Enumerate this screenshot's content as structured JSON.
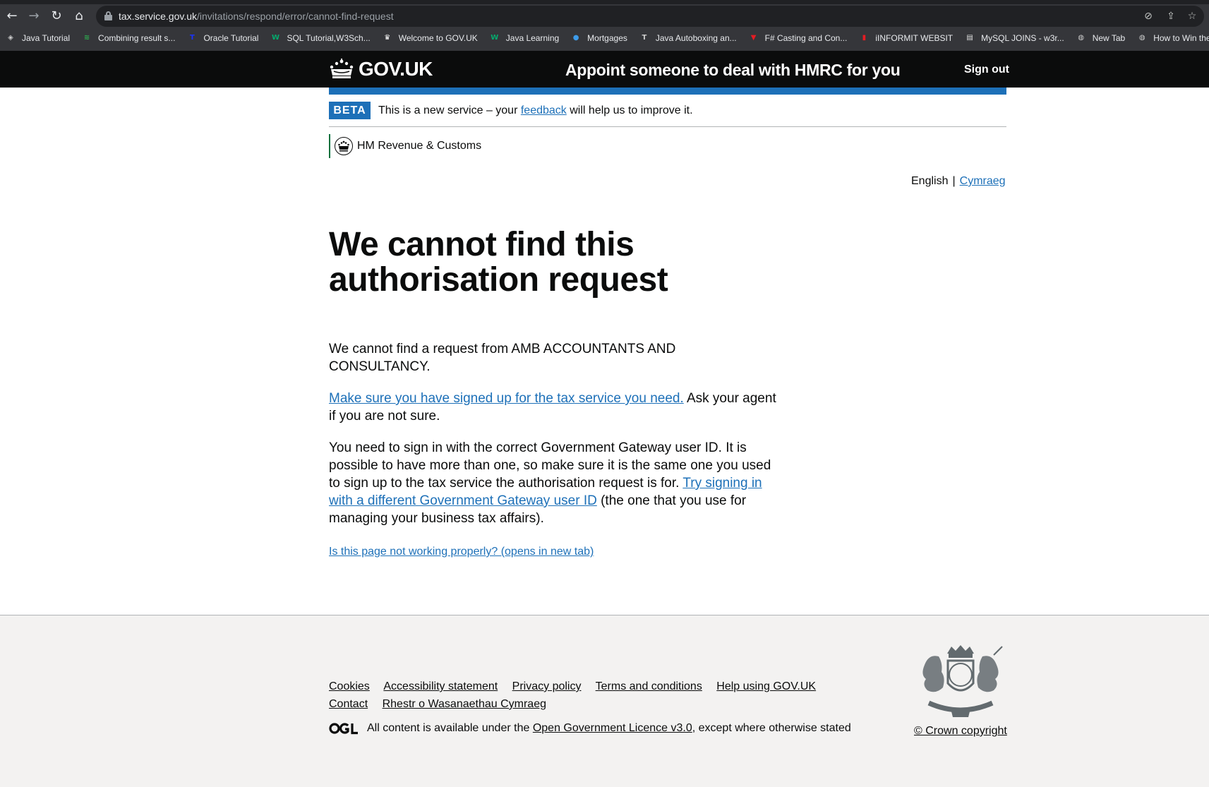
{
  "browser": {
    "url_host": "tax.service.gov.uk",
    "url_path": "/invitations/respond/error/cannot-find-request",
    "bookmarks": [
      {
        "label": "Java Tutorial",
        "icon": "tutorial-icon",
        "color": "#cccccc"
      },
      {
        "label": "Combining result s...",
        "icon": "stack-icon",
        "color": "#2fa84f"
      },
      {
        "label": "Oracle Tutorial",
        "icon": "t-letter-icon",
        "color": "#1a33ff"
      },
      {
        "label": "SQL Tutorial,W3Sch...",
        "icon": "w3-icon",
        "color": "#04aa6d"
      },
      {
        "label": "Welcome to GOV.UK",
        "icon": "crown-icon",
        "color": "#ffffff"
      },
      {
        "label": "Java Learning",
        "icon": "w3-icon",
        "color": "#04aa6d"
      },
      {
        "label": "Mortgages",
        "icon": "drop-icon",
        "color": "#3d9be9"
      },
      {
        "label": "Java Autoboxing an...",
        "icon": "t-serif-icon",
        "color": "#cccccc"
      },
      {
        "label": "F# Casting and Con...",
        "icon": "shield-icon",
        "color": "#e51c23"
      },
      {
        "label": "iINFORMIT WEBSIT",
        "icon": "bookmark-icon",
        "color": "#e51c23"
      },
      {
        "label": "MySQL JOINS - w3r...",
        "icon": "mysql-icon",
        "color": "#dddddd"
      },
      {
        "label": "New Tab",
        "icon": "globe-icon",
        "color": "#cccccc"
      },
      {
        "label": "How to Win the Chr...",
        "icon": "globe-icon",
        "color": "#cccccc"
      }
    ]
  },
  "header": {
    "logo_text": "GOV.UK",
    "service_name": "Appoint someone to deal with HMRC for you",
    "sign_out": "Sign out"
  },
  "phase_banner": {
    "tag": "BETA",
    "text_before": "This is a new service – your",
    "link": "feedback",
    "text_after": "will help us to improve it."
  },
  "organisation": "HM Revenue & Customs",
  "language": {
    "current": "English",
    "separator": "|",
    "other": "Cymraeg"
  },
  "main": {
    "heading": "We cannot find this authorisation request",
    "p1": "We cannot find a request from AMB ACCOUNTANTS AND CONSULTANCY.",
    "p2_link": "Make sure you have signed up for the tax service you need.",
    "p2_text": "Ask your agent if you are not sure.",
    "p3_text": "You need to sign in with the correct Government Gateway user ID. It is possible to have more than one, so make sure it is the same one you used to sign up to the tax service the authorisation request is for.",
    "p3_link": "Try signing in with a different Government Gateway user ID",
    "p3_after": "(the one that you use for managing your business tax affairs).",
    "report_link": "Is this page not working properly? (opens in new tab)"
  },
  "footer": {
    "links": [
      "Cookies",
      "Accessibility statement",
      "Privacy policy",
      "Terms and conditions",
      "Help using GOV.UK",
      "Contact",
      "Rhestr o Wasanaethau Cymraeg"
    ],
    "licence_before": "All content is available under the",
    "licence_link": "Open Government Licence v3.0",
    "licence_after": ", except where otherwise stated",
    "copyright": "© Crown copyright"
  },
  "colors": {
    "header_bg": "#0b0c0c",
    "brand_blue": "#1d70b8",
    "link": "#1d70b8",
    "footer_bg": "#f3f2f1",
    "org_border": "#00703c"
  }
}
